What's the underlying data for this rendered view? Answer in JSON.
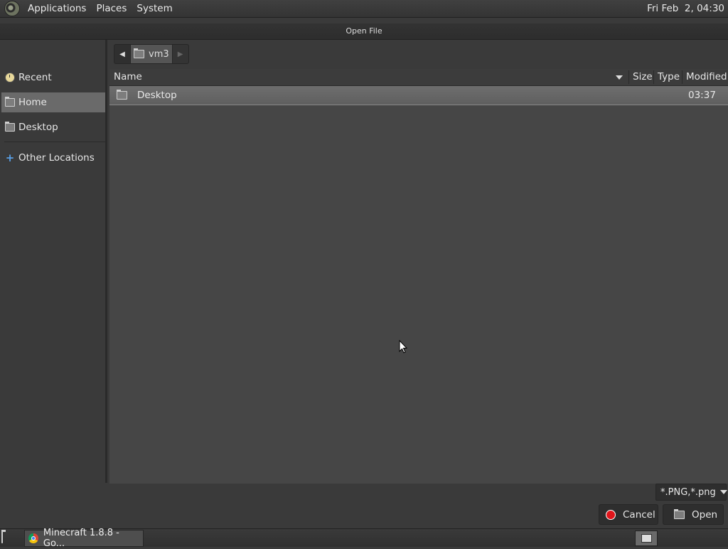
{
  "top_panel": {
    "menus": [
      "Applications",
      "Places",
      "System"
    ],
    "clock": "Fri Feb  2, 04:30"
  },
  "dialog": {
    "title": "Open File",
    "sidebar": {
      "items": [
        {
          "label": "Recent",
          "icon": "clock-icon"
        },
        {
          "label": "Home",
          "icon": "home-folder-icon",
          "selected": true
        },
        {
          "label": "Desktop",
          "icon": "folder-icon"
        },
        {
          "label": "Other Locations",
          "icon": "plus-icon"
        }
      ]
    },
    "pathbar": {
      "current": "vm3"
    },
    "file_list": {
      "columns": [
        "Name",
        "Size",
        "Type",
        "Modified"
      ],
      "rows": [
        {
          "name": "Desktop",
          "size": "",
          "type": "",
          "modified": "03:37",
          "icon": "folder-icon"
        }
      ]
    },
    "filter": {
      "value": "*.PNG,*.png"
    },
    "buttons": {
      "cancel": "Cancel",
      "open": "Open"
    }
  },
  "taskbar": {
    "task_item": "Minecraft 1.8.8 - Go..."
  },
  "colors": {
    "cancel_accent": "#e0151b",
    "selection": "#6a6a6a",
    "other_locations_plus": "#5aa0e6"
  }
}
